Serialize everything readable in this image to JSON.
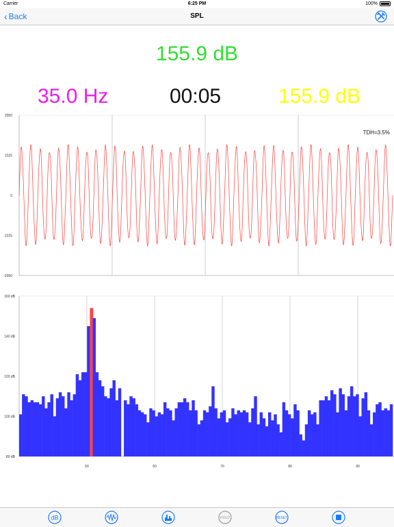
{
  "status": {
    "carrier": "Carrier",
    "time": "6:25 PM",
    "battery": "100%"
  },
  "nav": {
    "back": "Back",
    "title": "SPL"
  },
  "readout": {
    "level": "155.9 dB",
    "frequency": "35.0 Hz",
    "timer": "00:05",
    "peak": "155.9 dB"
  },
  "waveform": {
    "y_ticks": [
      "2050",
      "1025",
      "0",
      "-1025",
      "-2050"
    ],
    "annotation": "TDH=3.5%",
    "color": "#ff3a3a",
    "cycles": 40,
    "amplitude": 1300
  },
  "spectrum": {
    "y_ticks": [
      "160 dB",
      "140 dB",
      "120 dB",
      "100 dB",
      "80 dB"
    ],
    "x_ticks": [
      "50",
      "60",
      "70",
      "80",
      "90"
    ],
    "y_range": [
      80,
      160
    ],
    "bar_color": "#3333ff",
    "highlight_color": "#ff4444",
    "highlight_index": 25,
    "values": [
      101,
      111,
      110,
      107,
      108,
      107,
      107,
      106,
      110,
      104,
      107,
      111,
      100,
      109,
      112,
      110,
      104,
      112,
      108,
      111,
      121,
      118,
      122,
      122,
      145,
      154,
      149,
      122,
      118,
      115,
      110,
      109,
      114,
      118,
      108,
      114,
      80,
      108,
      106,
      110,
      109,
      106,
      103,
      102,
      101,
      97,
      104,
      103,
      100,
      102,
      101,
      107,
      104,
      103,
      98,
      104,
      107,
      107,
      109,
      107,
      103,
      108,
      103,
      96,
      98,
      103,
      102,
      105,
      115,
      104,
      99,
      102,
      103,
      97,
      99,
      104,
      101,
      103,
      102,
      103,
      102,
      97,
      104,
      110,
      96,
      102,
      99,
      95,
      102,
      98,
      101,
      96,
      92,
      107,
      103,
      101,
      99,
      106,
      103,
      91,
      88,
      96,
      103,
      101,
      102,
      96,
      108,
      108,
      110,
      108,
      113,
      111,
      102,
      114,
      111,
      103,
      110,
      115,
      110,
      111,
      100,
      109,
      112,
      103,
      96,
      102,
      106,
      107,
      103,
      104,
      103,
      106
    ]
  },
  "tabs": [
    {
      "key": "db",
      "label": "dB"
    },
    {
      "key": "wave",
      "label": "wave"
    },
    {
      "key": "spectrum",
      "label": "spectrum"
    },
    {
      "key": "hold",
      "label": "HOLD"
    },
    {
      "key": "reset",
      "label": "RESET"
    },
    {
      "key": "stop",
      "label": "stop"
    }
  ],
  "colors": {
    "accent": "#1a7bff",
    "level": "#2fe02f",
    "frequency": "#ee1bee",
    "peak": "#ffff00"
  }
}
